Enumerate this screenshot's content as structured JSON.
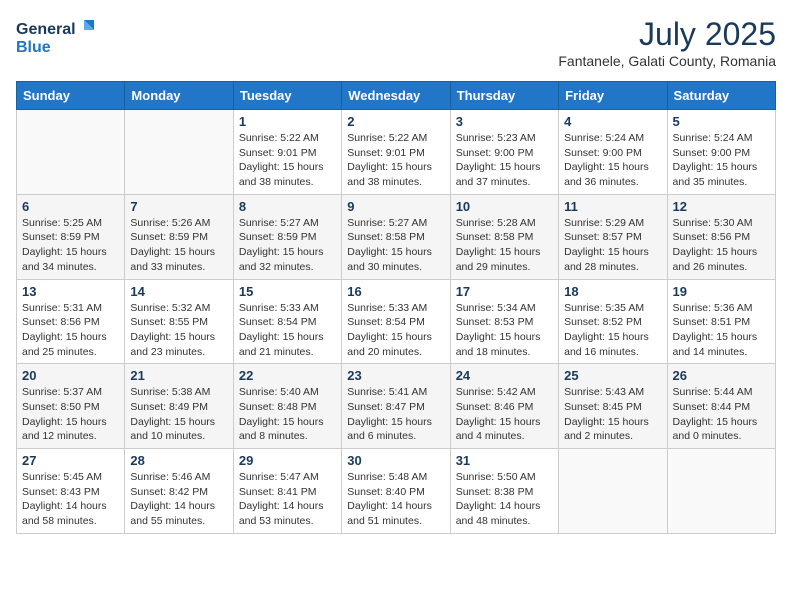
{
  "header": {
    "logo_general": "General",
    "logo_blue": "Blue",
    "month_year": "July 2025",
    "location": "Fantanele, Galati County, Romania"
  },
  "days_of_week": [
    "Sunday",
    "Monday",
    "Tuesday",
    "Wednesday",
    "Thursday",
    "Friday",
    "Saturday"
  ],
  "weeks": [
    [
      {
        "num": "",
        "detail": ""
      },
      {
        "num": "",
        "detail": ""
      },
      {
        "num": "1",
        "detail": "Sunrise: 5:22 AM\nSunset: 9:01 PM\nDaylight: 15 hours and 38 minutes."
      },
      {
        "num": "2",
        "detail": "Sunrise: 5:22 AM\nSunset: 9:01 PM\nDaylight: 15 hours and 38 minutes."
      },
      {
        "num": "3",
        "detail": "Sunrise: 5:23 AM\nSunset: 9:00 PM\nDaylight: 15 hours and 37 minutes."
      },
      {
        "num": "4",
        "detail": "Sunrise: 5:24 AM\nSunset: 9:00 PM\nDaylight: 15 hours and 36 minutes."
      },
      {
        "num": "5",
        "detail": "Sunrise: 5:24 AM\nSunset: 9:00 PM\nDaylight: 15 hours and 35 minutes."
      }
    ],
    [
      {
        "num": "6",
        "detail": "Sunrise: 5:25 AM\nSunset: 8:59 PM\nDaylight: 15 hours and 34 minutes."
      },
      {
        "num": "7",
        "detail": "Sunrise: 5:26 AM\nSunset: 8:59 PM\nDaylight: 15 hours and 33 minutes."
      },
      {
        "num": "8",
        "detail": "Sunrise: 5:27 AM\nSunset: 8:59 PM\nDaylight: 15 hours and 32 minutes."
      },
      {
        "num": "9",
        "detail": "Sunrise: 5:27 AM\nSunset: 8:58 PM\nDaylight: 15 hours and 30 minutes."
      },
      {
        "num": "10",
        "detail": "Sunrise: 5:28 AM\nSunset: 8:58 PM\nDaylight: 15 hours and 29 minutes."
      },
      {
        "num": "11",
        "detail": "Sunrise: 5:29 AM\nSunset: 8:57 PM\nDaylight: 15 hours and 28 minutes."
      },
      {
        "num": "12",
        "detail": "Sunrise: 5:30 AM\nSunset: 8:56 PM\nDaylight: 15 hours and 26 minutes."
      }
    ],
    [
      {
        "num": "13",
        "detail": "Sunrise: 5:31 AM\nSunset: 8:56 PM\nDaylight: 15 hours and 25 minutes."
      },
      {
        "num": "14",
        "detail": "Sunrise: 5:32 AM\nSunset: 8:55 PM\nDaylight: 15 hours and 23 minutes."
      },
      {
        "num": "15",
        "detail": "Sunrise: 5:33 AM\nSunset: 8:54 PM\nDaylight: 15 hours and 21 minutes."
      },
      {
        "num": "16",
        "detail": "Sunrise: 5:33 AM\nSunset: 8:54 PM\nDaylight: 15 hours and 20 minutes."
      },
      {
        "num": "17",
        "detail": "Sunrise: 5:34 AM\nSunset: 8:53 PM\nDaylight: 15 hours and 18 minutes."
      },
      {
        "num": "18",
        "detail": "Sunrise: 5:35 AM\nSunset: 8:52 PM\nDaylight: 15 hours and 16 minutes."
      },
      {
        "num": "19",
        "detail": "Sunrise: 5:36 AM\nSunset: 8:51 PM\nDaylight: 15 hours and 14 minutes."
      }
    ],
    [
      {
        "num": "20",
        "detail": "Sunrise: 5:37 AM\nSunset: 8:50 PM\nDaylight: 15 hours and 12 minutes."
      },
      {
        "num": "21",
        "detail": "Sunrise: 5:38 AM\nSunset: 8:49 PM\nDaylight: 15 hours and 10 minutes."
      },
      {
        "num": "22",
        "detail": "Sunrise: 5:40 AM\nSunset: 8:48 PM\nDaylight: 15 hours and 8 minutes."
      },
      {
        "num": "23",
        "detail": "Sunrise: 5:41 AM\nSunset: 8:47 PM\nDaylight: 15 hours and 6 minutes."
      },
      {
        "num": "24",
        "detail": "Sunrise: 5:42 AM\nSunset: 8:46 PM\nDaylight: 15 hours and 4 minutes."
      },
      {
        "num": "25",
        "detail": "Sunrise: 5:43 AM\nSunset: 8:45 PM\nDaylight: 15 hours and 2 minutes."
      },
      {
        "num": "26",
        "detail": "Sunrise: 5:44 AM\nSunset: 8:44 PM\nDaylight: 15 hours and 0 minutes."
      }
    ],
    [
      {
        "num": "27",
        "detail": "Sunrise: 5:45 AM\nSunset: 8:43 PM\nDaylight: 14 hours and 58 minutes."
      },
      {
        "num": "28",
        "detail": "Sunrise: 5:46 AM\nSunset: 8:42 PM\nDaylight: 14 hours and 55 minutes."
      },
      {
        "num": "29",
        "detail": "Sunrise: 5:47 AM\nSunset: 8:41 PM\nDaylight: 14 hours and 53 minutes."
      },
      {
        "num": "30",
        "detail": "Sunrise: 5:48 AM\nSunset: 8:40 PM\nDaylight: 14 hours and 51 minutes."
      },
      {
        "num": "31",
        "detail": "Sunrise: 5:50 AM\nSunset: 8:38 PM\nDaylight: 14 hours and 48 minutes."
      },
      {
        "num": "",
        "detail": ""
      },
      {
        "num": "",
        "detail": ""
      }
    ]
  ]
}
